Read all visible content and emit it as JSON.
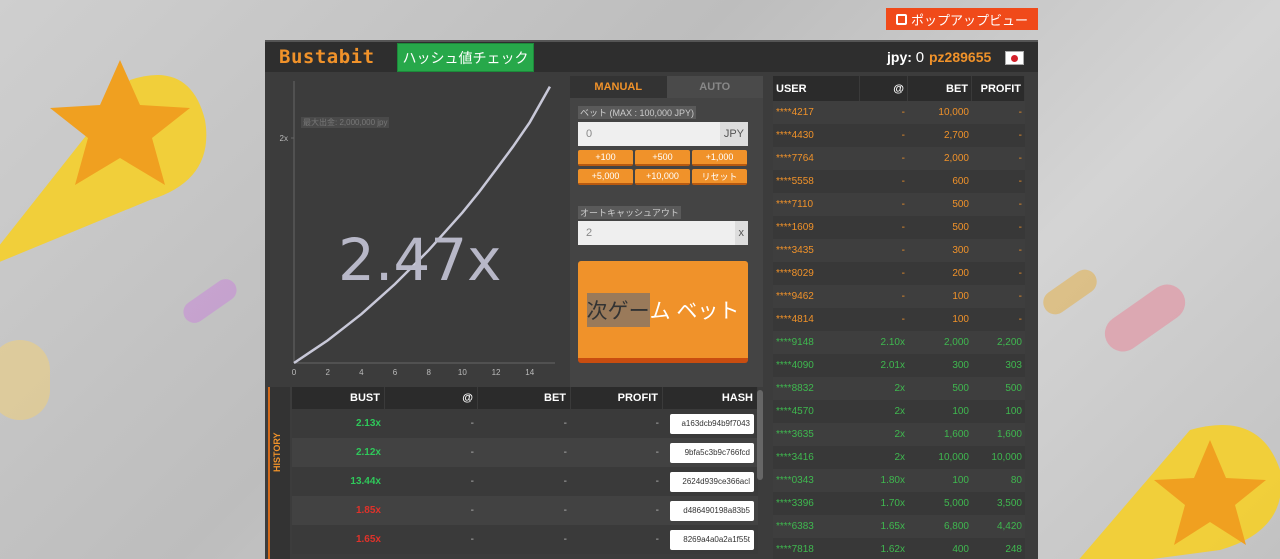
{
  "popup": {
    "label": "ポップアップビュー"
  },
  "header": {
    "logo": "Bustabit",
    "hash_check": "ハッシュ値チェック",
    "currency_label": "jpy:",
    "balance": "0",
    "username": "pz289655"
  },
  "chart": {
    "max_label": "最大出金: 2,000,000 jpy",
    "multiplier": "2.47x",
    "y_tick": "2x",
    "x_ticks": [
      "0",
      "2",
      "4",
      "6",
      "8",
      "10",
      "12",
      "14"
    ]
  },
  "chart_data": {
    "type": "line",
    "x": [
      0,
      1,
      2,
      3,
      4,
      5,
      6,
      7,
      8,
      9,
      10,
      11,
      12,
      13,
      14,
      15.2
    ],
    "y": [
      1.0,
      1.06,
      1.12,
      1.19,
      1.26,
      1.34,
      1.42,
      1.51,
      1.6,
      1.7,
      1.8,
      1.91,
      2.03,
      2.15,
      2.28,
      2.47
    ],
    "xlim": [
      0,
      15.5
    ],
    "ylim": [
      1,
      2.5
    ],
    "x_tick_labels": [
      "0",
      "2",
      "4",
      "6",
      "8",
      "10",
      "12",
      "14"
    ],
    "y_tick_labels": [
      "2x"
    ],
    "grid": false
  },
  "controls": {
    "tab_manual": "MANUAL",
    "tab_auto": "AUTO",
    "bet_label": "ベット (MAX : 100,000 JPY)",
    "bet_value": "0",
    "bet_unit": "JPY",
    "quick": [
      "+100",
      "+500",
      "+1,000",
      "+5,000",
      "+10,000",
      "リセット"
    ],
    "cashout_label": "オートキャッシュアウト",
    "cashout_value": "2",
    "cashout_unit": "x",
    "bet_button_part1": "次ゲー",
    "bet_button_part2": "ム ベット"
  },
  "history": {
    "side_label": "HISTORY",
    "headers": [
      "BUST",
      "@",
      "BET",
      "PROFIT",
      "HASH"
    ],
    "rows": [
      {
        "bust": "2.13x",
        "at": "-",
        "bet": "-",
        "profit": "-",
        "hash": "a163dcb94b9f7043",
        "color": "green"
      },
      {
        "bust": "2.12x",
        "at": "-",
        "bet": "-",
        "profit": "-",
        "hash": "9bfa5c3b9c766fcd",
        "color": "green"
      },
      {
        "bust": "13.44x",
        "at": "-",
        "bet": "-",
        "profit": "-",
        "hash": "2624d939ce366acl",
        "color": "green"
      },
      {
        "bust": "1.85x",
        "at": "-",
        "bet": "-",
        "profit": "-",
        "hash": "d486490198a83b5",
        "color": "red"
      },
      {
        "bust": "1.65x",
        "at": "-",
        "bet": "-",
        "profit": "-",
        "hash": "8269a4a0a2a1f55t",
        "color": "red"
      }
    ]
  },
  "players": {
    "headers": [
      "USER",
      "@",
      "BET",
      "PROFIT"
    ],
    "rows": [
      {
        "user": "****4217",
        "at": "-",
        "bet": "10,000",
        "profit": "-",
        "status": "orange"
      },
      {
        "user": "****4430",
        "at": "-",
        "bet": "2,700",
        "profit": "-",
        "status": "orange"
      },
      {
        "user": "****7764",
        "at": "-",
        "bet": "2,000",
        "profit": "-",
        "status": "orange"
      },
      {
        "user": "****5558",
        "at": "-",
        "bet": "600",
        "profit": "-",
        "status": "orange"
      },
      {
        "user": "****7110",
        "at": "-",
        "bet": "500",
        "profit": "-",
        "status": "orange"
      },
      {
        "user": "****1609",
        "at": "-",
        "bet": "500",
        "profit": "-",
        "status": "orange"
      },
      {
        "user": "****3435",
        "at": "-",
        "bet": "300",
        "profit": "-",
        "status": "orange"
      },
      {
        "user": "****8029",
        "at": "-",
        "bet": "200",
        "profit": "-",
        "status": "orange"
      },
      {
        "user": "****9462",
        "at": "-",
        "bet": "100",
        "profit": "-",
        "status": "orange"
      },
      {
        "user": "****4814",
        "at": "-",
        "bet": "100",
        "profit": "-",
        "status": "orange"
      },
      {
        "user": "****9148",
        "at": "2.10x",
        "bet": "2,000",
        "profit": "2,200",
        "status": "green"
      },
      {
        "user": "****4090",
        "at": "2.01x",
        "bet": "300",
        "profit": "303",
        "status": "green"
      },
      {
        "user": "****8832",
        "at": "2x",
        "bet": "500",
        "profit": "500",
        "status": "green"
      },
      {
        "user": "****4570",
        "at": "2x",
        "bet": "100",
        "profit": "100",
        "status": "green"
      },
      {
        "user": "****3635",
        "at": "2x",
        "bet": "1,600",
        "profit": "1,600",
        "status": "green"
      },
      {
        "user": "****3416",
        "at": "2x",
        "bet": "10,000",
        "profit": "10,000",
        "status": "green"
      },
      {
        "user": "****0343",
        "at": "1.80x",
        "bet": "100",
        "profit": "80",
        "status": "green"
      },
      {
        "user": "****3396",
        "at": "1.70x",
        "bet": "5,000",
        "profit": "3,500",
        "status": "green"
      },
      {
        "user": "****6383",
        "at": "1.65x",
        "bet": "6,800",
        "profit": "4,420",
        "status": "green"
      },
      {
        "user": "****7818",
        "at": "1.62x",
        "bet": "400",
        "profit": "248",
        "status": "green"
      }
    ]
  },
  "colors": {
    "accent": "#f0922a",
    "win": "#2fc85a",
    "loss": "#e0322a",
    "panel": "#3c3c3c",
    "popup": "#f04a1a",
    "hash_button": "#27a84a"
  }
}
